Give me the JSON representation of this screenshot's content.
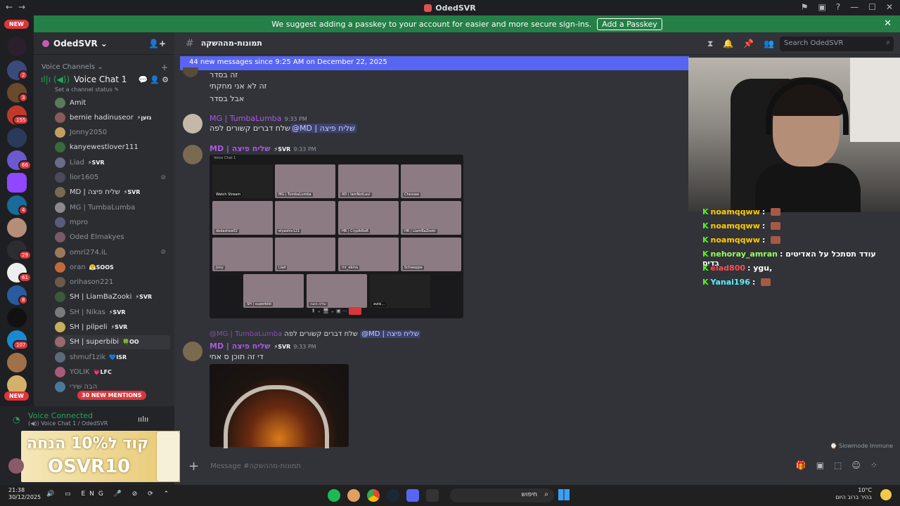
{
  "window": {
    "title": "OdedSVR",
    "controls": [
      "—",
      "☐",
      "✕"
    ]
  },
  "banner": {
    "text": "We suggest adding a passkey to your account for easier and more secure sign-ins.",
    "button": "Add a Passkey"
  },
  "guilds": {
    "new_badge_top": "NEW",
    "new_badge_bottom": "NEW",
    "counts": [
      "2",
      "3",
      "155",
      "66",
      "4",
      "29",
      "61",
      "8",
      "107"
    ]
  },
  "server": {
    "name": "OdedSVR",
    "category": "Voice Channels",
    "voice_channel": "Voice Chat 1",
    "channel_status": "Set a channel status"
  },
  "members": [
    {
      "name": "Amit",
      "tag": "",
      "dim": false
    },
    {
      "name": "bernie hadinuseor",
      "tag": "⚡גזען",
      "dim": false
    },
    {
      "name": "Jonny2050",
      "tag": "",
      "dim": true
    },
    {
      "name": "kanyewestlover111",
      "tag": "",
      "dim": false
    },
    {
      "name": "Liad",
      "tag": "⚡SVR",
      "dim": true
    },
    {
      "name": "lior1605",
      "tag": "",
      "dim": true
    },
    {
      "name": "MD | שליח פיצה",
      "tag": "⚡SVR",
      "dim": false
    },
    {
      "name": "MG | TumbaLumba",
      "tag": "",
      "dim": true
    },
    {
      "name": "mpro",
      "tag": "",
      "dim": true
    },
    {
      "name": "Oded Elmakyes",
      "tag": "",
      "dim": true
    },
    {
      "name": "omri274.iL",
      "tag": "",
      "dim": true
    },
    {
      "name": "oran",
      "tag": "😤SOOS",
      "dim": true
    },
    {
      "name": "orihason221",
      "tag": "",
      "dim": true
    },
    {
      "name": "SH | LiamBaZooki",
      "tag": "⚡SVR",
      "dim": false
    },
    {
      "name": "SH | Nikas",
      "tag": "⚡SVR",
      "dim": true
    },
    {
      "name": "SH | pilpeli",
      "tag": "⚡SVR",
      "dim": false
    },
    {
      "name": "SH | superbibi",
      "tag": "🍀OO",
      "dim": false
    },
    {
      "name": "shmuf1zik",
      "tag": "💙ISR",
      "dim": true
    },
    {
      "name": "YOLIK",
      "tag": "💗LFC",
      "dim": true
    },
    {
      "name": "הבה שירי",
      "tag": "",
      "dim": true
    }
  ],
  "mentions_pill": "30 NEW MENTIONS",
  "voice": {
    "status": "Voice Connected",
    "detail": "Voice Chat 1 / OdedSVR"
  },
  "ad": {
    "line1": "קוד ל10% הנחה",
    "line2": "OSVR10"
  },
  "channel": {
    "name": "תמונות-מההשקה",
    "search_placeholder": "Search OdedSVR",
    "composer_placeholder": "Message #תמונות-מההשקה"
  },
  "new_messages_bar": "44 new messages since 9:25 AM on December 22, 2025",
  "messages": {
    "lines_top": [
      "זה בסדר",
      "זה לא אני מחקתי",
      "אבל בסדר"
    ],
    "m1": {
      "author": "MG | TumbaLumba",
      "time": "9:33 PM",
      "text": "שלח דברים קשורים לפה",
      "mention": "@MD | שליח פיצה"
    },
    "m2": {
      "author": "MD | שליח פיצה",
      "tag": "⚡SVR",
      "time": "9:33 PM"
    },
    "reply": {
      "author": "@MG | TumbaLumba",
      "text": "שלח דברים קשורים לפה",
      "mention": "@MD | שליח פיצה"
    },
    "m3": {
      "author": "MD | שליח פיצה",
      "tag": "⚡SVR",
      "time": "9:33 PM",
      "text": "די זה תוכן ס אחי"
    }
  },
  "screenshot_tiles": [
    "Watch Stream",
    "MG | TumbaLumba",
    "AD | IamNotLavi",
    "Chessee",
    "dedashee02",
    "elyashiv121",
    "HR | CrypikBaR",
    "HR | LiamBaZooki",
    "Jony",
    "Liad",
    "mr_ekina",
    "Schweppe",
    "SH | superbibi",
    "שליח פיצה",
    "avisi..."
  ],
  "screenshot_header": "Voice Chat 1",
  "slowmode": "Slowmode Immune",
  "stream_chat": [
    {
      "user": "noamqqww",
      "text": "",
      "color": "#ffcc00"
    },
    {
      "user": "noamqqww",
      "text": "",
      "color": "#ffcc00"
    },
    {
      "user": "noamqqww",
      "text": "",
      "color": "#ffcc00"
    },
    {
      "user": "nehoray_amran",
      "text": "עודד תסתכל על האדיטים בדיס",
      "color": "#9aff5a"
    },
    {
      "user": "elad800",
      "text": "ygu,",
      "color": "#ff4d4d"
    },
    {
      "user": "Yanai196",
      "text": "",
      "color": "#5af0ff"
    }
  ],
  "taskbar": {
    "time": "21:38",
    "date": "30/12/2025",
    "lang": "ENG",
    "search": "חיפוש",
    "weather_temp": "10°C",
    "weather_text": "בהיר ברוב היום"
  }
}
